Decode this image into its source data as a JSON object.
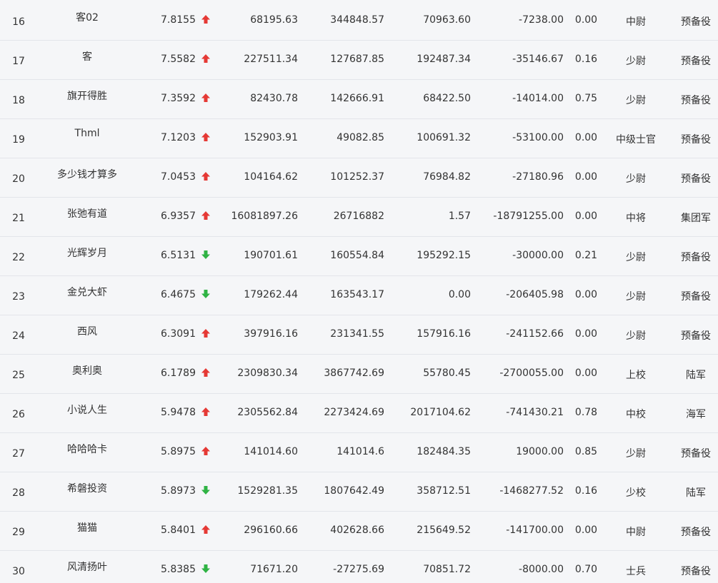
{
  "colors": {
    "up": "#e53935",
    "down": "#2fb344"
  },
  "rows": [
    {
      "rank": "16",
      "name": "客02",
      "score": "7.8155",
      "trend": "up",
      "v1": "68195.63",
      "v2": "344848.57",
      "v3": "70963.60",
      "v4": "-7238.00",
      "ratio": "0.00",
      "military_rank": "中尉",
      "branch": "预备役"
    },
    {
      "rank": "17",
      "name": "客",
      "score": "7.5582",
      "trend": "up",
      "v1": "227511.34",
      "v2": "127687.85",
      "v3": "192487.34",
      "v4": "-35146.67",
      "ratio": "0.16",
      "military_rank": "少尉",
      "branch": "预备役"
    },
    {
      "rank": "18",
      "name": "旗开得胜",
      "score": "7.3592",
      "trend": "up",
      "v1": "82430.78",
      "v2": "142666.91",
      "v3": "68422.50",
      "v4": "-14014.00",
      "ratio": "0.75",
      "military_rank": "少尉",
      "branch": "预备役"
    },
    {
      "rank": "19",
      "name": "Thml",
      "score": "7.1203",
      "trend": "up",
      "v1": "152903.91",
      "v2": "49082.85",
      "v3": "100691.32",
      "v4": "-53100.00",
      "ratio": "0.00",
      "military_rank": "中级士官",
      "branch": "预备役"
    },
    {
      "rank": "20",
      "name": "多少钱才算多",
      "score": "7.0453",
      "trend": "up",
      "v1": "104164.62",
      "v2": "101252.37",
      "v3": "76984.82",
      "v4": "-27180.96",
      "ratio": "0.00",
      "military_rank": "少尉",
      "branch": "预备役"
    },
    {
      "rank": "21",
      "name": "张弛有道",
      "score": "6.9357",
      "trend": "up",
      "v1": "16081897.26",
      "v2": "26716882",
      "v3": "1.57",
      "v4": "-18791255.00",
      "ratio": "0.00",
      "military_rank": "中将",
      "branch": "集团军"
    },
    {
      "rank": "22",
      "name": "光辉岁月",
      "score": "6.5131",
      "trend": "down",
      "v1": "190701.61",
      "v2": "160554.84",
      "v3": "195292.15",
      "v4": "-30000.00",
      "ratio": "0.21",
      "military_rank": "少尉",
      "branch": "预备役"
    },
    {
      "rank": "23",
      "name": "金兑大虾",
      "score": "6.4675",
      "trend": "down",
      "v1": "179262.44",
      "v2": "163543.17",
      "v3": "0.00",
      "v4": "-206405.98",
      "ratio": "0.00",
      "military_rank": "少尉",
      "branch": "预备役"
    },
    {
      "rank": "24",
      "name": "西风",
      "score": "6.3091",
      "trend": "up",
      "v1": "397916.16",
      "v2": "231341.55",
      "v3": "157916.16",
      "v4": "-241152.66",
      "ratio": "0.00",
      "military_rank": "少尉",
      "branch": "预备役"
    },
    {
      "rank": "25",
      "name": "奥利奥",
      "score": "6.1789",
      "trend": "up",
      "v1": "2309830.34",
      "v2": "3867742.69",
      "v3": "55780.45",
      "v4": "-2700055.00",
      "ratio": "0.00",
      "military_rank": "上校",
      "branch": "陆军"
    },
    {
      "rank": "26",
      "name": "小说人生",
      "score": "5.9478",
      "trend": "up",
      "v1": "2305562.84",
      "v2": "2273424.69",
      "v3": "2017104.62",
      "v4": "-741430.21",
      "ratio": "0.78",
      "military_rank": "中校",
      "branch": "海军"
    },
    {
      "rank": "27",
      "name": "哈哈哈卡",
      "score": "5.8975",
      "trend": "up",
      "v1": "141014.60",
      "v2": "141014.6",
      "v3": "182484.35",
      "v4": "19000.00",
      "ratio": "0.85",
      "military_rank": "少尉",
      "branch": "预备役"
    },
    {
      "rank": "28",
      "name": "希磐投资",
      "score": "5.8973",
      "trend": "down",
      "v1": "1529281.35",
      "v2": "1807642.49",
      "v3": "358712.51",
      "v4": "-1468277.52",
      "ratio": "0.16",
      "military_rank": "少校",
      "branch": "陆军"
    },
    {
      "rank": "29",
      "name": "猫猫",
      "score": "5.8401",
      "trend": "up",
      "v1": "296160.66",
      "v2": "402628.66",
      "v3": "215649.52",
      "v4": "-141700.00",
      "ratio": "0.00",
      "military_rank": "中尉",
      "branch": "预备役"
    },
    {
      "rank": "30",
      "name": "风清扬叶",
      "score": "5.8385",
      "trend": "down",
      "v1": "71671.20",
      "v2": "-27275.69",
      "v3": "70851.72",
      "v4": "-8000.00",
      "ratio": "0.70",
      "military_rank": "士兵",
      "branch": "预备役"
    }
  ]
}
